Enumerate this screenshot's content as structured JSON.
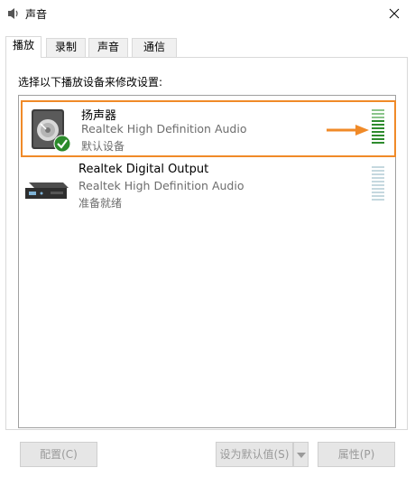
{
  "window": {
    "title": "声音",
    "icon": "speaker-icon",
    "close_icon": "close-icon"
  },
  "tabs": [
    {
      "label": "播放",
      "active": true
    },
    {
      "label": "录制",
      "active": false
    },
    {
      "label": "声音",
      "active": false
    },
    {
      "label": "通信",
      "active": false
    }
  ],
  "instruction": "选择以下播放设备来修改设置:",
  "devices": [
    {
      "name": "扬声器",
      "driver": "Realtek High Definition Audio",
      "status": "默认设备",
      "icon": "speaker-device-icon",
      "badge": "default-check-icon",
      "selected": true,
      "level_active": true
    },
    {
      "name": "Realtek Digital Output",
      "driver": "Realtek High Definition Audio",
      "status": "准备就绪",
      "icon": "digital-output-icon",
      "selected": false,
      "level_active": false
    }
  ],
  "annotation": {
    "arrow_color": "#f08a28",
    "highlight_color": "#f08a28"
  },
  "buttons": {
    "configure": "配置(C)",
    "set_default": "设为默认值(S)",
    "properties": "属性(P)"
  },
  "colors": {
    "level_green": "#2e8b2e",
    "level_idle": "#c5d8df"
  }
}
